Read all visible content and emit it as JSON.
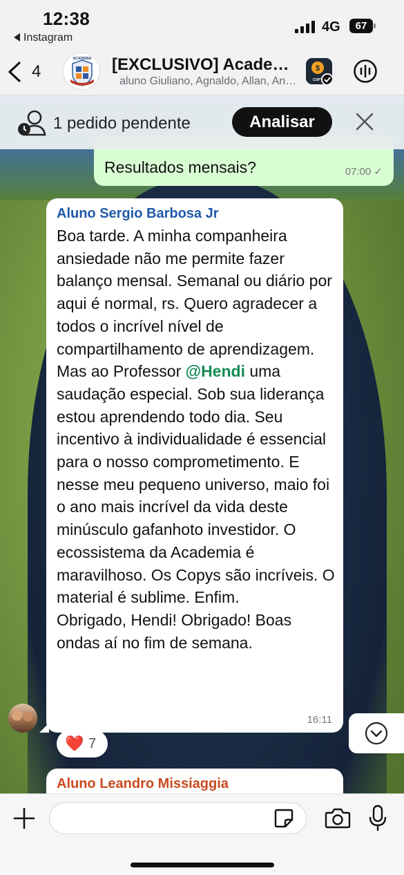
{
  "status_bar": {
    "time": "12:38",
    "back_app": "Instagram",
    "network": "4G",
    "battery": "67"
  },
  "header": {
    "back_count": "4",
    "title": "[EXCLUSIVO] Academia Copy",
    "subtitle": "aluno Giuliano, Agnaldo, Allan, Andre",
    "avatar_text": "ACADEMIA",
    "app_icon_text": "COPY"
  },
  "banner": {
    "text": "1 pedido pendente",
    "button_label": "Analisar"
  },
  "messages": [
    {
      "direction": "outgoing",
      "text": "Resultados mensais?",
      "time": "07:00",
      "status": "✓"
    },
    {
      "direction": "incoming",
      "sender": "Aluno Sergio Barbosa Jr",
      "sender_color": "#1e5aa8",
      "text_before_mention": "Boa tarde. A minha companheira ansiedade não me permite fazer balanço mensal. Semanal ou diário por aqui é normal, rs. Quero agradecer a todos o incrível nível de compartilhamento de aprendizagem. Mas ao Professor ",
      "mention": "@Hendi",
      "text_after_mention": " uma saudação especial. Sob sua liderança estou aprendendo todo dia. Seu incentivo à individualidade é essencial para o nosso comprometimento. E nesse meu pequeno universo, maio foi o ano mais incrível da vida deste minúsculo gafanhoto investidor. O ecossistema da Academia é maravilhoso. Os Copys são incríveis. O material é sublime. Enfim.",
      "text_closing": "Obrigado, Hendi! Obrigado! Boas ondas aí no fim de semana.",
      "time": "16:11",
      "reaction_emoji": "❤️",
      "reaction_count": "7"
    },
    {
      "direction": "incoming",
      "sender": "Aluno Leandro Missiaggia",
      "sender_color": "#c84a1e"
    }
  ],
  "composer": {
    "value": "",
    "placeholder": ""
  },
  "colors": {
    "outgoing_bubble": "#d9fdd3",
    "mention": "#148b52",
    "analisar_button": "#111111"
  },
  "icons": {
    "back": "chevron-left-icon",
    "call": "audio-call-icon",
    "banner": "pending-request-icon",
    "close": "close-icon",
    "scroll": "chevron-down-icon",
    "plus": "plus-icon",
    "sticker": "sticker-icon",
    "camera": "camera-icon",
    "mic": "microphone-icon"
  }
}
